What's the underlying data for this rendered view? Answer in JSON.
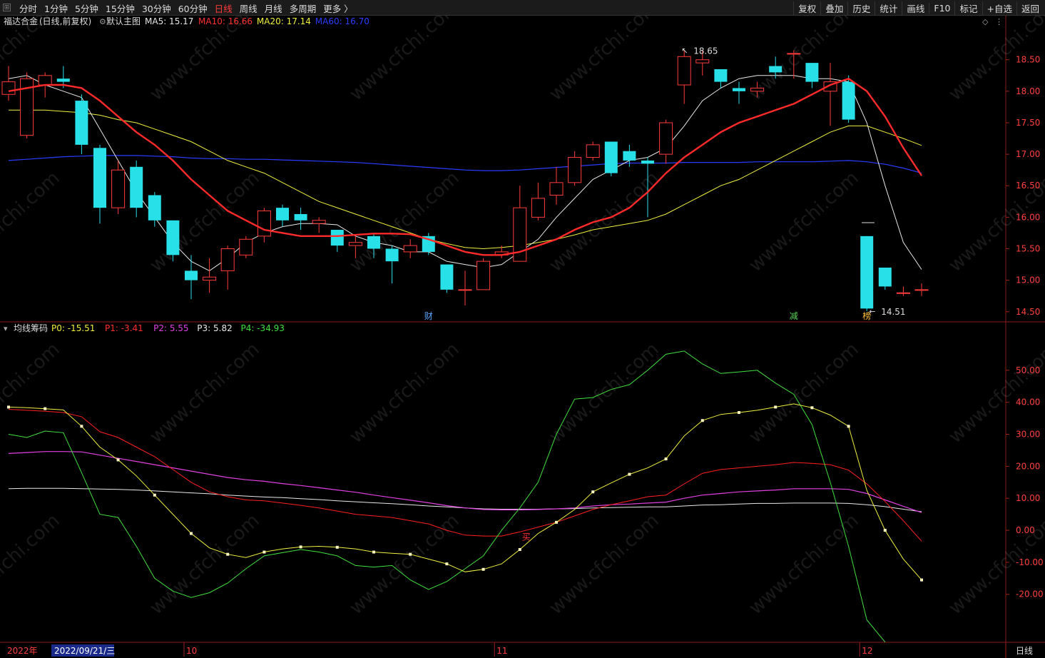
{
  "toolbar": {
    "grip": "⊞",
    "periods": [
      "分时",
      "1分钟",
      "5分钟",
      "15分钟",
      "30分钟",
      "60分钟",
      "日线",
      "周线",
      "月线",
      "多周期",
      "更多 〉"
    ],
    "active_period": "日线",
    "actions": [
      "复权",
      "叠加",
      "历史",
      "统计",
      "画线",
      "F10",
      "标记",
      "+自选",
      "返回"
    ]
  },
  "main_panel": {
    "stock_name": "福达合金",
    "mode": "(日线,前复权)",
    "template": "默认主图",
    "legend": [
      {
        "label": "MA5: 15.17",
        "color": "#e8e8e8"
      },
      {
        "label": "MA10: 16.66",
        "color": "#ff3030"
      },
      {
        "label": "MA20: 17.14",
        "color": "#f0f040"
      },
      {
        "label": "MA60: 16.70",
        "color": "#2a3cff"
      }
    ],
    "high_label": "18.65",
    "low_label": "14.51",
    "markers": [
      {
        "text": "财",
        "color": "#5aa8ff",
        "index": 23
      },
      {
        "text": "减",
        "color": "#5ad35a",
        "index": 43
      },
      {
        "text": "榜",
        "color": "#ffc040",
        "index": 47
      }
    ],
    "price_axis": [
      "18.50",
      "18.00",
      "17.50",
      "17.00",
      "16.50",
      "16.00",
      "15.50",
      "15.00",
      "14.50"
    ]
  },
  "sub_panel": {
    "indicator": "均线筹码",
    "legend": [
      {
        "label": "P0: -15.51",
        "color": "#f0f040"
      },
      {
        "label": "P1: -3.41",
        "color": "#ff3030"
      },
      {
        "label": "P2: 5.55",
        "color": "#e040e0"
      },
      {
        "label": "P3: 5.82",
        "color": "#e8e8e8"
      },
      {
        "label": "P4: -34.93",
        "color": "#40e040"
      }
    ],
    "buy_label": "买",
    "value_axis": [
      "50.00",
      "40.00",
      "30.00",
      "20.00",
      "10.00",
      "0.00",
      "-10.00",
      "-20.00"
    ]
  },
  "bottom_bar": {
    "year": "2022年",
    "cursor_date": "2022/09/21/三",
    "months": [
      "10",
      "11",
      "12"
    ],
    "period": "日线"
  },
  "chart_data": {
    "type": "candlestick",
    "price_range": [
      14.35,
      18.95
    ],
    "candles": [
      [
        17.95,
        18.15,
        18.4,
        17.85
      ],
      [
        17.3,
        18.2,
        18.3,
        17.25
      ],
      [
        18.1,
        18.25,
        18.3,
        17.9
      ],
      [
        18.2,
        18.15,
        18.4,
        18.05
      ],
      [
        17.85,
        17.15,
        17.95,
        17.0
      ],
      [
        17.1,
        16.15,
        17.15,
        15.9
      ],
      [
        16.15,
        16.75,
        16.9,
        16.05
      ],
      [
        16.8,
        16.15,
        16.9,
        16.0
      ],
      [
        16.35,
        15.95,
        16.4,
        15.85
      ],
      [
        15.95,
        15.4,
        15.95,
        15.3
      ],
      [
        15.15,
        15.0,
        15.4,
        14.7
      ],
      [
        15.0,
        15.05,
        15.35,
        14.8
      ],
      [
        15.15,
        15.5,
        15.55,
        14.85
      ],
      [
        15.4,
        15.65,
        15.7,
        15.35
      ],
      [
        15.7,
        16.1,
        16.15,
        15.6
      ],
      [
        16.15,
        15.95,
        16.2,
        15.85
      ],
      [
        16.05,
        15.95,
        16.15,
        15.8
      ],
      [
        15.9,
        15.95,
        16.0,
        15.75
      ],
      [
        15.8,
        15.55,
        15.8,
        15.45
      ],
      [
        15.55,
        15.6,
        15.7,
        15.35
      ],
      [
        15.7,
        15.5,
        15.75,
        15.35
      ],
      [
        15.5,
        15.3,
        15.55,
        14.95
      ],
      [
        15.45,
        15.55,
        15.65,
        15.35
      ],
      [
        15.7,
        15.45,
        15.75,
        15.4
      ],
      [
        15.25,
        14.85,
        15.25,
        14.8
      ],
      [
        14.85,
        14.85,
        15.15,
        14.6
      ],
      [
        14.85,
        15.3,
        15.35,
        14.85
      ],
      [
        15.4,
        15.45,
        15.55,
        15.35
      ],
      [
        15.3,
        16.15,
        16.5,
        15.3
      ],
      [
        16.0,
        16.3,
        16.55,
        15.95
      ],
      [
        16.35,
        16.55,
        16.8,
        16.2
      ],
      [
        16.55,
        16.95,
        17.05,
        16.5
      ],
      [
        16.95,
        17.15,
        17.2,
        16.9
      ],
      [
        17.2,
        16.7,
        17.2,
        16.65
      ],
      [
        17.05,
        16.9,
        17.15,
        16.8
      ],
      [
        16.9,
        16.85,
        16.95,
        16.0
      ],
      [
        17.0,
        17.5,
        17.55,
        16.85
      ],
      [
        18.1,
        18.55,
        18.65,
        17.8
      ],
      [
        18.45,
        18.5,
        18.65,
        18.25
      ],
      [
        18.35,
        18.15,
        18.35,
        18.05
      ],
      [
        18.05,
        18.0,
        18.15,
        17.8
      ],
      [
        18.0,
        18.05,
        18.15,
        17.9
      ],
      [
        18.4,
        18.3,
        18.55,
        18.2
      ],
      [
        18.6,
        18.6,
        18.65,
        18.2
      ],
      [
        18.45,
        18.15,
        18.45,
        18.05
      ],
      [
        18.0,
        18.15,
        18.45,
        17.45
      ],
      [
        18.15,
        17.55,
        18.25,
        17.5
      ],
      [
        15.7,
        14.55,
        15.7,
        14.51
      ],
      [
        15.2,
        14.9,
        15.2,
        14.85
      ],
      [
        14.8,
        14.8,
        14.9,
        14.75
      ],
      [
        14.85,
        14.85,
        14.95,
        14.75
      ]
    ],
    "ma5": [
      18.2,
      18.25,
      18.1,
      18.0,
      17.9,
      17.4,
      16.9,
      16.4,
      16.0,
      15.6,
      15.3,
      15.15,
      15.35,
      15.6,
      15.75,
      15.85,
      15.9,
      15.9,
      15.88,
      15.7,
      15.6,
      15.55,
      15.45,
      15.45,
      15.3,
      15.25,
      15.2,
      15.25,
      15.45,
      15.65,
      16.0,
      16.3,
      16.6,
      16.75,
      16.9,
      16.95,
      17.1,
      17.45,
      17.85,
      18.05,
      18.2,
      18.25,
      18.25,
      18.25,
      18.2,
      18.2,
      18.15,
      17.5,
      16.5,
      15.6,
      15.17
    ],
    "ma10": [
      18.0,
      18.05,
      18.1,
      18.1,
      18.05,
      17.85,
      17.6,
      17.35,
      17.15,
      16.9,
      16.6,
      16.35,
      16.1,
      15.95,
      15.8,
      15.75,
      15.7,
      15.7,
      15.7,
      15.72,
      15.74,
      15.74,
      15.73,
      15.65,
      15.55,
      15.45,
      15.4,
      15.4,
      15.45,
      15.55,
      15.65,
      15.8,
      15.92,
      16.0,
      16.15,
      16.4,
      16.7,
      16.95,
      17.15,
      17.35,
      17.5,
      17.6,
      17.7,
      17.8,
      17.95,
      18.1,
      18.2,
      18.0,
      17.6,
      17.1,
      16.66
    ],
    "ma20": [
      17.7,
      17.7,
      17.7,
      17.68,
      17.66,
      17.62,
      17.55,
      17.5,
      17.4,
      17.3,
      17.2,
      17.05,
      16.9,
      16.8,
      16.7,
      16.55,
      16.4,
      16.25,
      16.15,
      16.05,
      15.95,
      15.85,
      15.75,
      15.65,
      15.58,
      15.52,
      15.5,
      15.52,
      15.55,
      15.6,
      15.65,
      15.72,
      15.8,
      15.85,
      15.9,
      15.95,
      16.05,
      16.2,
      16.35,
      16.5,
      16.6,
      16.75,
      16.9,
      17.05,
      17.2,
      17.35,
      17.45,
      17.45,
      17.35,
      17.25,
      17.14
    ],
    "ma60": [
      16.9,
      16.92,
      16.94,
      16.96,
      16.97,
      16.98,
      16.98,
      16.98,
      16.97,
      16.96,
      16.94,
      16.93,
      16.93,
      16.92,
      16.92,
      16.91,
      16.9,
      16.89,
      16.88,
      16.87,
      16.85,
      16.83,
      16.81,
      16.79,
      16.77,
      16.75,
      16.74,
      16.74,
      16.75,
      16.77,
      16.79,
      16.81,
      16.83,
      16.85,
      16.86,
      16.86,
      16.86,
      16.87,
      16.87,
      16.87,
      16.87,
      16.88,
      16.88,
      16.88,
      16.88,
      16.89,
      16.9,
      16.88,
      16.84,
      16.78,
      16.7
    ],
    "osc_range": [
      -35,
      60
    ],
    "p0": [
      38.5,
      38.3,
      38.0,
      37.6,
      32.5,
      26.0,
      22.0,
      17.0,
      11.0,
      5.0,
      -1.0,
      -5.5,
      -7.5,
      -8.5,
      -6.8,
      -5.8,
      -5.2,
      -5.0,
      -5.3,
      -5.8,
      -6.8,
      -7.2,
      -7.5,
      -9.0,
      -10.5,
      -13.0,
      -12.2,
      -10.5,
      -6.0,
      -1.0,
      2.5,
      6.5,
      12.0,
      14.8,
      17.5,
      19.5,
      22.3,
      29.5,
      34.3,
      36.2,
      36.8,
      37.5,
      38.5,
      39.5,
      38.3,
      36.0,
      32.5,
      12.5,
      0.0,
      -9.0,
      -15.51
    ],
    "p1": [
      37.8,
      37.5,
      37.2,
      36.8,
      35.5,
      30.8,
      29.0,
      26.0,
      23.0,
      19.0,
      15.0,
      12.0,
      10.5,
      9.5,
      9.2,
      8.5,
      7.8,
      7.0,
      6.0,
      5.0,
      4.5,
      4.0,
      3.0,
      2.0,
      0.0,
      -1.5,
      -1.8,
      -1.8,
      -0.5,
      1.0,
      2.5,
      4.5,
      6.5,
      8.0,
      9.2,
      10.5,
      11.0,
      14.5,
      17.8,
      19.0,
      19.5,
      20.0,
      20.5,
      21.2,
      20.9,
      20.5,
      18.8,
      14.5,
      9.0,
      3.0,
      -3.41
    ],
    "p2": [
      24.0,
      24.3,
      24.6,
      24.6,
      24.5,
      23.5,
      22.5,
      21.5,
      20.5,
      19.5,
      18.5,
      17.5,
      16.5,
      15.8,
      15.3,
      14.6,
      14.0,
      13.3,
      12.6,
      11.9,
      11.0,
      10.2,
      9.4,
      8.6,
      7.7,
      7.0,
      6.5,
      6.4,
      6.4,
      6.5,
      6.7,
      7.0,
      7.6,
      8.0,
      8.2,
      8.5,
      8.8,
      10.0,
      11.0,
      11.5,
      12.0,
      12.3,
      12.6,
      13.0,
      13.0,
      13.0,
      12.8,
      11.5,
      9.5,
      7.5,
      5.55
    ],
    "p3": [
      13.0,
      13.1,
      13.1,
      13.1,
      13.0,
      12.9,
      12.8,
      12.6,
      12.3,
      12.0,
      11.7,
      11.4,
      11.0,
      10.7,
      10.4,
      10.2,
      9.9,
      9.6,
      9.2,
      8.9,
      8.6,
      8.3,
      8.0,
      7.6,
      7.3,
      7.0,
      6.7,
      6.6,
      6.6,
      6.6,
      6.7,
      6.8,
      7.0,
      7.1,
      7.2,
      7.3,
      7.3,
      7.6,
      7.9,
      8.0,
      8.2,
      8.4,
      8.4,
      8.5,
      8.5,
      8.5,
      8.4,
      8.0,
      7.4,
      6.6,
      5.82
    ],
    "p4": [
      30.0,
      29.0,
      31.0,
      30.5,
      18.0,
      5.0,
      4.0,
      -5.0,
      -15.0,
      -19.0,
      -21.0,
      -19.5,
      -16.5,
      -12.0,
      -8.0,
      -7.0,
      -6.0,
      -6.8,
      -8.0,
      -11.0,
      -11.5,
      -11.0,
      -15.5,
      -18.5,
      -16.0,
      -12.0,
      -8.0,
      0.0,
      7.0,
      15.0,
      30.0,
      41.0,
      41.5,
      44.0,
      45.5,
      50.0,
      55.0,
      56.0,
      52.0,
      49.0,
      49.5,
      50.0,
      46.0,
      42.5,
      33.0,
      15.0,
      -5.0,
      -28.0,
      -34.93
    ],
    "p4_note": "P4 series trimmed to visible green curve"
  }
}
